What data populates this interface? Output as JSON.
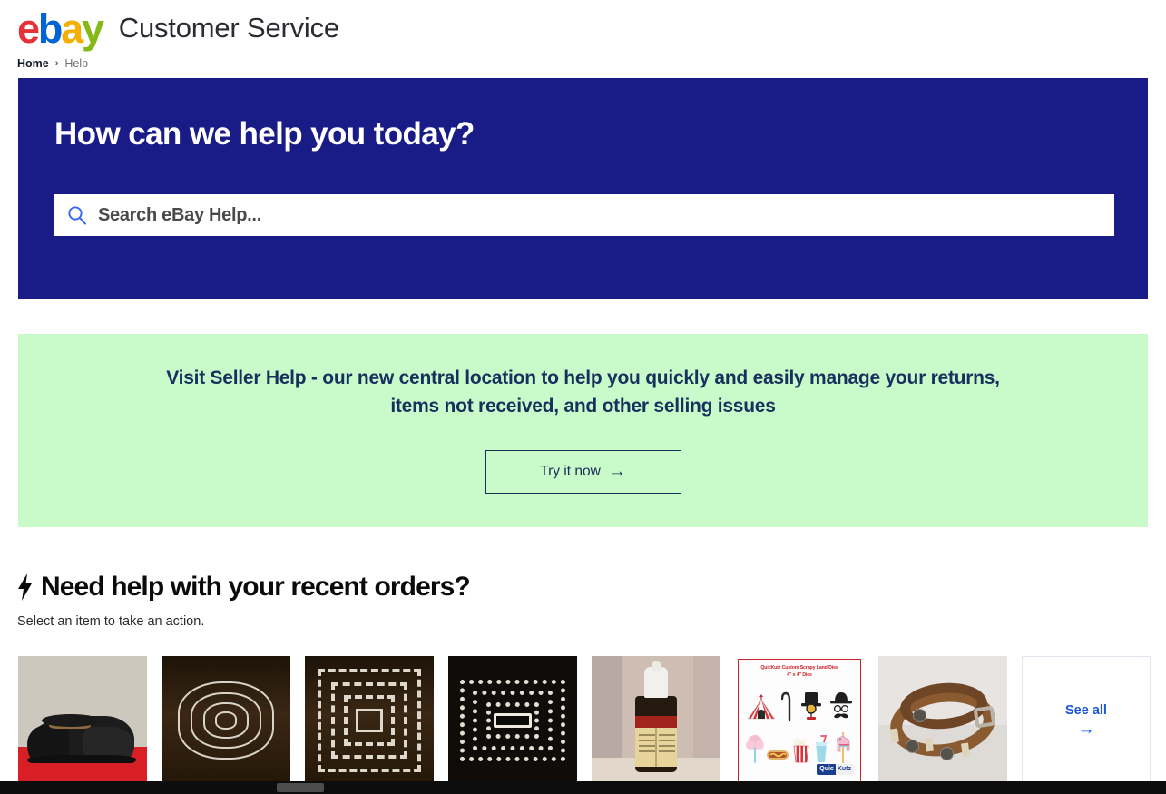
{
  "header": {
    "logo_letters": [
      "e",
      "b",
      "a",
      "y"
    ],
    "logo_colors": [
      "#E53238",
      "#0064D2",
      "#F5AF02",
      "#86B817"
    ],
    "title": "Customer Service"
  },
  "breadcrumb": {
    "home_label": "Home",
    "separator": "›",
    "current_label": "Help"
  },
  "hero": {
    "heading": "How can we help you today?",
    "background_color": "#191C87",
    "search": {
      "placeholder": "Search eBay Help...",
      "value": "",
      "icon": "search-icon"
    }
  },
  "promo": {
    "background_color": "#C9FBCA",
    "text_color": "#18305E",
    "message": "Visit Seller Help - our new central location to help you quickly and easily manage your returns, items not received, and other selling issues",
    "button_label": "Try it now",
    "button_arrow": "→"
  },
  "orders": {
    "icon": "lightning-bolt-icon",
    "title": "Need help with your recent orders?",
    "subtitle": "Select an item to take an action.",
    "items": [
      {
        "name": "black-leather-dress-shoe",
        "alt": "Black leather cap-toe dress shoe on red surface"
      },
      {
        "name": "quatrefoil-nesting-die",
        "alt": "Quatrefoil shaped nesting metal dies on dark wood"
      },
      {
        "name": "zigzag-square-nesting-die",
        "alt": "Zigzag chevron square nesting metal dies"
      },
      {
        "name": "scalloped-rectangle-die",
        "alt": "Scalloped rectangle nesting metal dies"
      },
      {
        "name": "dropper-bottle",
        "alt": "Small amber dropper bottle with white cap and red-cream label"
      },
      {
        "name": "quickutz-circus-die-package",
        "alt": "QuicKutz circus themed die cut package"
      },
      {
        "name": "leather-concho-belt",
        "alt": "Brown leather belt with silver conchos"
      }
    ],
    "see_all": {
      "label": "See all",
      "arrow": "→",
      "color": "#1B57D6"
    }
  },
  "package": {
    "title_line1": "QuicKutz Custom Scrapy Land Dies",
    "title_line2": "4\" x 4\" Dies",
    "brand_part1": "Quic",
    "brand_part2": "Kutz",
    "title_color": "#CC1F26",
    "motifs_row1": [
      "circus-tent",
      "cane",
      "top-hat-monocle",
      "bowler-hat-mustache"
    ],
    "motifs_row2": [
      "cotton-candy",
      "hot-dog",
      "popcorn",
      "milkshake",
      "carousel-horse"
    ]
  }
}
